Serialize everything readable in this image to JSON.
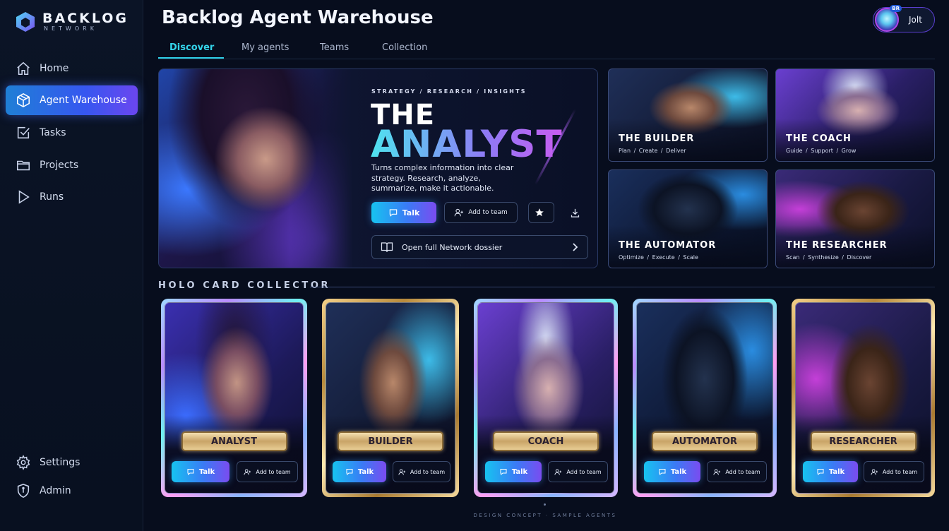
{
  "brand": {
    "name": "BACKLOG",
    "sub": "NETWORK"
  },
  "sidebar": {
    "items": [
      {
        "label": "Home",
        "icon": "home-icon"
      },
      {
        "label": "Agent Warehouse",
        "icon": "cube-icon",
        "active": true
      },
      {
        "label": "Tasks",
        "icon": "checkbox-icon"
      },
      {
        "label": "Projects",
        "icon": "folder-icon"
      },
      {
        "label": "Runs",
        "icon": "play-icon"
      }
    ],
    "bottom": [
      {
        "label": "Settings",
        "icon": "gear-icon"
      },
      {
        "label": "Admin",
        "icon": "shield-icon"
      }
    ]
  },
  "header": {
    "title": "Backlog Agent Warehouse"
  },
  "user": {
    "name": "Jolt",
    "badge": "BR"
  },
  "tabs": [
    {
      "label": "Discover",
      "active": true
    },
    {
      "label": "My agents"
    },
    {
      "label": "Teams"
    },
    {
      "label": "Collection"
    }
  ],
  "hero": {
    "tags": "STRATEGY  /  RESEARCH  /  INSIGHTS",
    "the": "THE",
    "name": "ANALYST",
    "description": "Turns complex information into clear strategy. Research, analyze, summarize, make it actionable.",
    "talk_label": "Talk",
    "add_label": "Add to team",
    "dossier_label": "Open full Network dossier"
  },
  "agents": [
    {
      "name": "THE BUILDER",
      "sub": "Plan  /  Create  /  Deliver"
    },
    {
      "name": "THE COACH",
      "sub": "Guide  /  Support  /  Grow"
    },
    {
      "name": "THE AUTOMATOR",
      "sub": "Optimize  /  Execute  /  Scale"
    },
    {
      "name": "THE RESEARCHER",
      "sub": "Scan  /  Synthesize  /  Discover"
    }
  ],
  "collector": {
    "title": "HOLO CARD COLLECTOR",
    "talk_label": "Talk",
    "add_label": "Add to team",
    "cards": [
      {
        "name": "ANALYST",
        "frame": "silver"
      },
      {
        "name": "BUILDER",
        "frame": "gold"
      },
      {
        "name": "COACH",
        "frame": "silver"
      },
      {
        "name": "AUTOMATOR",
        "frame": "silver"
      },
      {
        "name": "RESEARCHER",
        "frame": "gold"
      }
    ]
  },
  "footer": {
    "note": "DESIGN CONCEPT  ·  SAMPLE AGENTS"
  },
  "colors": {
    "accent": "#2fd0e8",
    "primary": "#3a7bf5",
    "violet": "#7a4cf0",
    "background": "#070d1d"
  }
}
